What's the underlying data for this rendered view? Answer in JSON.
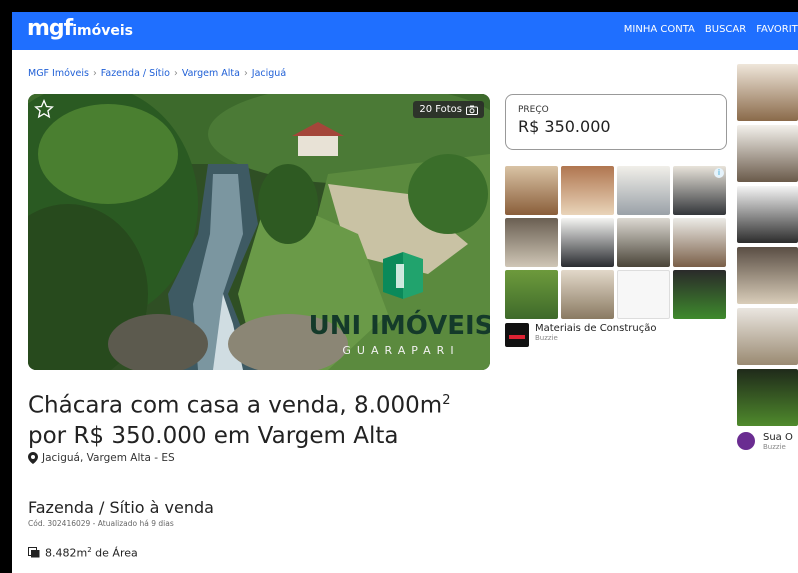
{
  "header": {
    "logo_main": "mgf",
    "logo_sub": "imóveis",
    "nav": [
      "MINHA CONTA",
      "BUSCAR",
      "FAVORITOS"
    ]
  },
  "breadcrumb": [
    "MGF Imóveis",
    "Fazenda / Sítio",
    "Vargem Alta",
    "Jaciguá"
  ],
  "breadcrumb_sep": "›",
  "photo": {
    "count_label": "20 Fotos",
    "watermark_main": "UNI IMÓVEIS",
    "watermark_sub": "GUARAPARI"
  },
  "price": {
    "label": "PREÇO",
    "value": "R$ 350.000"
  },
  "ad": {
    "title": "Materiais de Construção",
    "source": "Buzzie"
  },
  "strip_ad": {
    "title": "Sua O",
    "source": "Buzzie"
  },
  "listing": {
    "title_line1": "Chácara com casa a venda, 8.000m",
    "title_sup": "2",
    "title_line2": "por R$ 350.000 em Vargem Alta",
    "location": "Jaciguá, Vargem Alta - ES",
    "type": "Fazenda / Sítio à venda",
    "code": "Cód. 302416029 - Atualizado há 9 dias",
    "area_value": "8.482m",
    "area_sup": "2",
    "area_suffix": " de Área"
  },
  "colors": {
    "brand": "#1f6fff",
    "link": "#1f5fd6"
  }
}
